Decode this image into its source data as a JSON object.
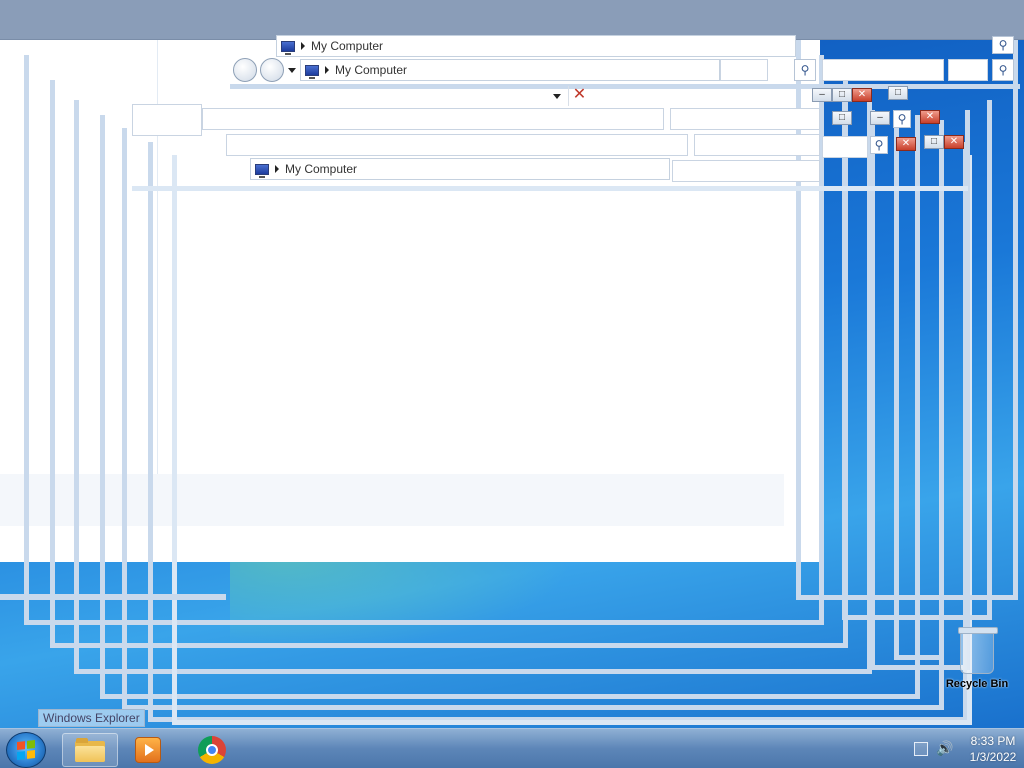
{
  "explorer": {
    "address_label": "My Computer"
  },
  "taskbar": {
    "tooltip": "Windows Explorer",
    "items": [
      {
        "name": "windows-explorer",
        "icon": "folder-icon"
      },
      {
        "name": "media-player",
        "icon": "media-player-icon"
      },
      {
        "name": "chrome",
        "icon": "chrome-icon"
      }
    ]
  },
  "tray": {
    "time": "8:33 PM",
    "date": "1/3/2022"
  },
  "desktop": {
    "recycle_bin_label": "Recycle Bin"
  },
  "colors": {
    "taskbar": "#5d86b8",
    "desktop": "#1a78d8",
    "top_band": "#8a9db8"
  }
}
